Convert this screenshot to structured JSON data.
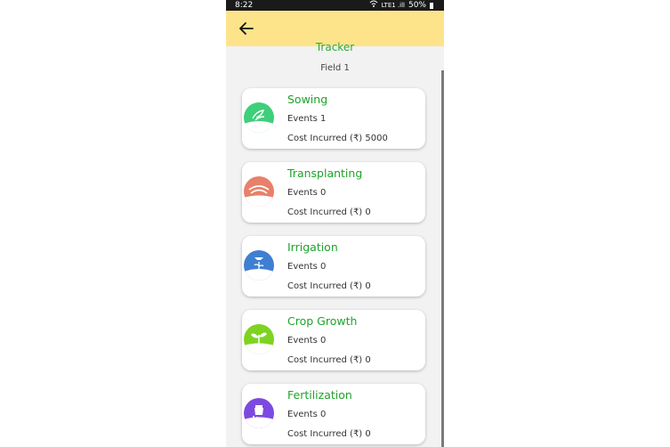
{
  "status_bar": {
    "time": "8:22",
    "signal": "LTE1 .ill",
    "battery": "50%"
  },
  "header": {
    "back_icon": "arrow-left-icon",
    "title": "Tracker",
    "subtitle": "Field 1"
  },
  "colors": {
    "appbar": "#fde48b",
    "accent_green": "#1ea32a",
    "background": "#f2f2f2"
  },
  "activities": [
    {
      "name": "Sowing",
      "events": "Events 1",
      "cost": "Cost Incurred (₹) 5000",
      "icon": "sowing-icon",
      "color": "#3ecf7a"
    },
    {
      "name": "Transplanting",
      "events": "Events 0",
      "cost": "Cost Incurred (₹) 0",
      "icon": "transplanting-icon",
      "color": "#e8806a"
    },
    {
      "name": "Irrigation",
      "events": "Events 0",
      "cost": "Cost Incurred (₹) 0",
      "icon": "irrigation-icon",
      "color": "#3f7fd1"
    },
    {
      "name": "Crop Growth",
      "events": "Events 0",
      "cost": "Cost Incurred (₹) 0",
      "icon": "crop-growth-icon",
      "color": "#7ed321"
    },
    {
      "name": "Fertilization",
      "events": "Events 0",
      "cost": "Cost Incurred (₹) 0",
      "icon": "fertilization-icon",
      "color": "#7d4ae0"
    }
  ]
}
